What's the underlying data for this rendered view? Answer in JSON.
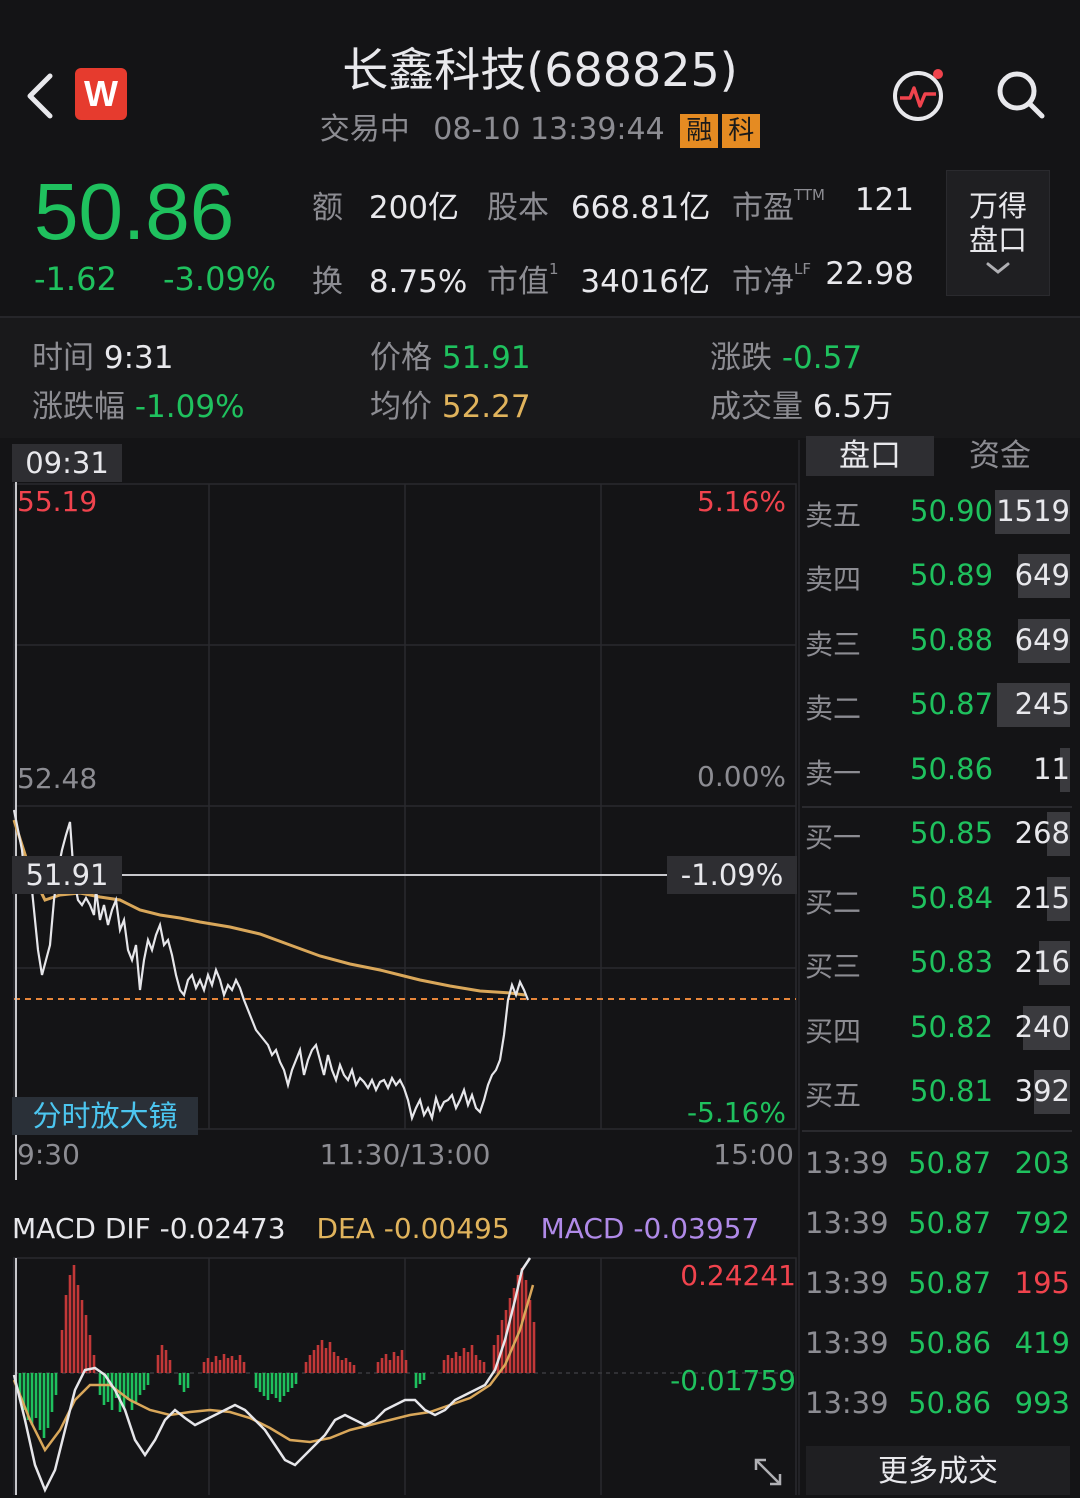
{
  "header": {
    "title": "长鑫科技(688825)",
    "status": "交易中",
    "datetime": "08-10 13:39:44",
    "tag1": "融",
    "tag2": "科",
    "logo": "W"
  },
  "quote": {
    "price": "50.86",
    "change": "-1.62",
    "change_pct": "-3.09%",
    "stats": [
      {
        "label": "额",
        "value": "200亿"
      },
      {
        "label": "股本",
        "value": "668.81亿"
      },
      {
        "label": "市盈",
        "sup": "TTM",
        "value": "121"
      },
      {
        "label": "换",
        "value": "8.75%"
      },
      {
        "label": "市值",
        "sup": "1",
        "value": "34016亿"
      },
      {
        "label": "市净",
        "sup": "LF",
        "value": "22.98"
      }
    ],
    "panel_button_line1": "万得",
    "panel_button_line2": "盘口"
  },
  "crosshair_info": {
    "time_label": "时间",
    "time_value": "9:31",
    "price_label": "价格",
    "price_value": "51.91",
    "change_label": "涨跌",
    "change_value": "-0.57",
    "pct_label": "涨跌幅",
    "pct_value": "-1.09%",
    "avg_label": "均价",
    "avg_value": "52.27",
    "volume_label": "成交量",
    "volume_value": "6.5万"
  },
  "intraday_chart": {
    "cursor_time": "09:31",
    "price_high": "55.19",
    "price_mid": "52.48",
    "pct_high": "5.16%",
    "pct_mid": "0.00%",
    "pct_low": "-5.16%",
    "cursor_price": "51.91",
    "cursor_pct": "-1.09%",
    "magnifier_label": "分时放大镜",
    "x_ticks": [
      "9:30",
      "11:30/13:00",
      "15:00"
    ]
  },
  "macd": {
    "dif_label": "MACD DIF -0.02473",
    "dea_label": "DEA -0.00495",
    "macd_label": "MACD -0.03957",
    "axis_top": "0.24241",
    "axis_bottom": "-0.01759"
  },
  "order_book": {
    "tabs": [
      "盘口",
      "资金"
    ],
    "asks": [
      {
        "label": "卖五",
        "price": "50.90",
        "volume": "1519",
        "bar": 0.29
      },
      {
        "label": "卖四",
        "price": "50.89",
        "volume": "649",
        "bar": 0.2
      },
      {
        "label": "卖三",
        "price": "50.88",
        "volume": "649",
        "bar": 0.2
      },
      {
        "label": "卖二",
        "price": "50.87",
        "volume": "245",
        "bar": 0.28
      },
      {
        "label": "卖一",
        "price": "50.86",
        "volume": "11",
        "bar": 0.04
      }
    ],
    "bids": [
      {
        "label": "买一",
        "price": "50.85",
        "volume": "268",
        "bar": 0.09
      },
      {
        "label": "买二",
        "price": "50.84",
        "volume": "215",
        "bar": 0.09
      },
      {
        "label": "买三",
        "price": "50.83",
        "volume": "216",
        "bar": 0.12
      },
      {
        "label": "买四",
        "price": "50.82",
        "volume": "240",
        "bar": 0.18
      },
      {
        "label": "买五",
        "price": "50.81",
        "volume": "392",
        "bar": 0.14
      }
    ]
  },
  "ticks": [
    {
      "time": "13:39",
      "price": "50.87",
      "volume": "203",
      "color": "#1fc15e"
    },
    {
      "time": "13:39",
      "price": "50.87",
      "volume": "792",
      "color": "#1fc15e"
    },
    {
      "time": "13:39",
      "price": "50.87",
      "volume": "195",
      "color": "#f0434d"
    },
    {
      "time": "13:39",
      "price": "50.86",
      "volume": "419",
      "color": "#1fc15e"
    },
    {
      "time": "13:39",
      "price": "50.86",
      "volume": "993",
      "color": "#1fc15e"
    }
  ],
  "more_trades": "更多成交",
  "colors": {
    "up": "#f0434d",
    "down": "#1fc15e",
    "avg": "#e0b35c",
    "bg": "#141416"
  }
}
